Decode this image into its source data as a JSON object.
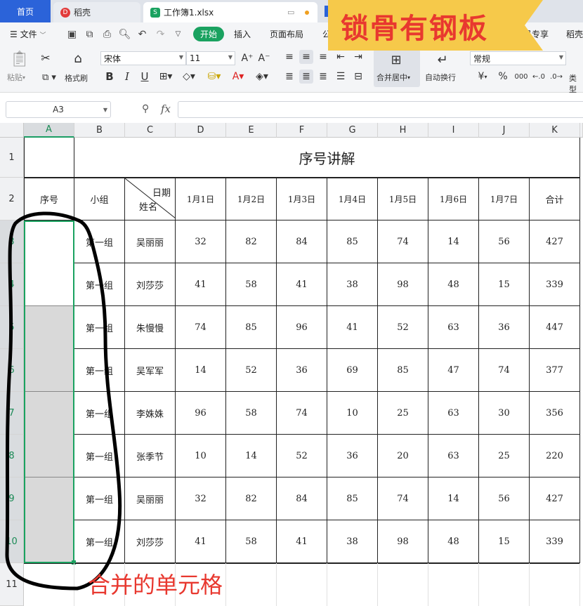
{
  "tabs": {
    "home": "首页",
    "docer": "稻壳",
    "workbook": "工作簿1.xlsx"
  },
  "menu": {
    "file": "文件",
    "start": "开始",
    "insert": "插入",
    "page_layout": "页面布局",
    "formula_partial": "公",
    "vip": "会员专享",
    "docer": "稻壳"
  },
  "ribbon": {
    "paste": "粘贴",
    "format_painter": "格式刷",
    "font_name": "宋体",
    "font_size": "11",
    "bold": "B",
    "italic": "I",
    "underline": "U",
    "merge_center": "合并居中",
    "wrap_text": "自动换行",
    "number_format": "常规",
    "currency": "¥",
    "percent": "%",
    "thousands": "000",
    "type_convert": "类型"
  },
  "formula_bar": {
    "cell_ref": "A3",
    "fx": "fx",
    "value": ""
  },
  "columns": [
    "A",
    "B",
    "C",
    "D",
    "E",
    "F",
    "G",
    "H",
    "I",
    "J",
    "K"
  ],
  "rows": [
    "1",
    "2",
    "3",
    "4",
    "5",
    "6",
    "7",
    "8",
    "9",
    "10",
    "11"
  ],
  "sheet": {
    "title": "序号讲解",
    "headers": {
      "index": "序号",
      "group": "小组",
      "diag_top": "日期",
      "diag_bottom": "姓名",
      "dates": [
        "1月1日",
        "1月2日",
        "1月3日",
        "1月4日",
        "1月5日",
        "1月6日",
        "1月7日"
      ],
      "total": "合计"
    },
    "records": [
      {
        "group": "第一组",
        "name": "吴丽丽",
        "values": [
          32,
          82,
          84,
          85,
          74,
          14,
          56
        ],
        "total": 427
      },
      {
        "group": "第一组",
        "name": "刘莎莎",
        "values": [
          41,
          58,
          41,
          38,
          98,
          48,
          15
        ],
        "total": 339
      },
      {
        "group": "第一组",
        "name": "朱慢慢",
        "values": [
          74,
          85,
          96,
          41,
          52,
          63,
          36
        ],
        "total": 447
      },
      {
        "group": "第一组",
        "name": "吴军军",
        "values": [
          14,
          52,
          36,
          69,
          85,
          47,
          74
        ],
        "total": 377
      },
      {
        "group": "第一组",
        "name": "李姝姝",
        "values": [
          96,
          58,
          74,
          10,
          25,
          63,
          30
        ],
        "total": 356
      },
      {
        "group": "第一组",
        "name": "张季节",
        "values": [
          10,
          14,
          52,
          36,
          20,
          63,
          25
        ],
        "total": 220
      },
      {
        "group": "第一组",
        "name": "吴丽丽",
        "values": [
          32,
          82,
          84,
          85,
          74,
          14,
          56
        ],
        "total": 427
      },
      {
        "group": "第一组",
        "name": "刘莎莎",
        "values": [
          41,
          58,
          41,
          38,
          98,
          48,
          15
        ],
        "total": 339
      }
    ]
  },
  "annotations": {
    "banner": "锁骨有钢板",
    "merged_note": "合并的单元格"
  },
  "colors": {
    "accent_green": "#1aa260",
    "home_tab": "#2b63d9",
    "banner_bg": "#f6c94a",
    "annotation_red": "#e8382f",
    "merged_fill": "#d9d9d9"
  }
}
